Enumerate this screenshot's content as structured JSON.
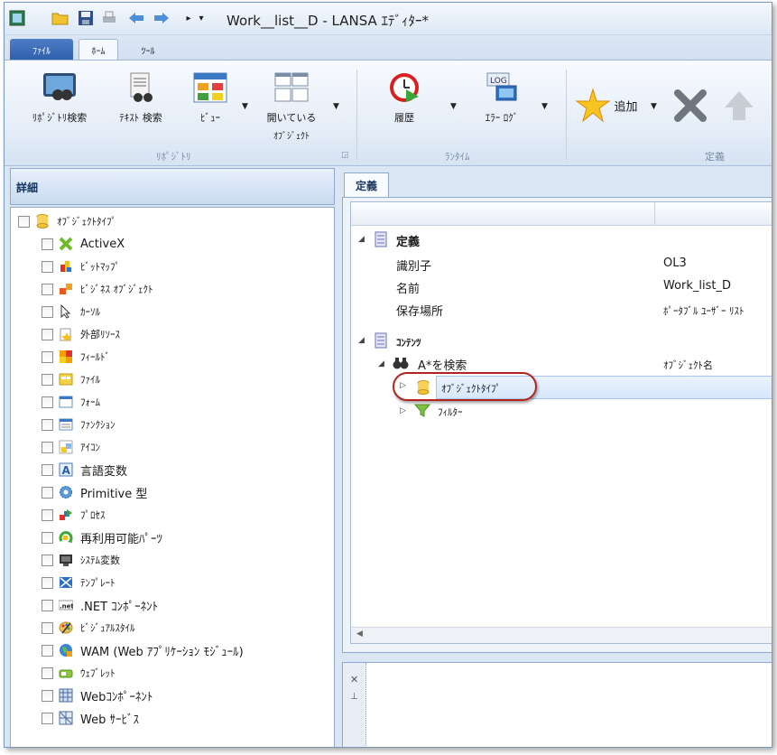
{
  "window": {
    "title": "Work__list__D - LANSA ｴﾃﾞｨﾀｰ*"
  },
  "ribbon_tabs": {
    "file": "ﾌｧｲﾙ",
    "home": "ﾎｰﾑ",
    "tools": "ﾂｰﾙ"
  },
  "ribbon": {
    "repo_search": "ﾘﾎﾟｼﾞﾄﾘ検索",
    "text_search": "ﾃｷｽﾄ 検索",
    "view": "ﾋﾞｭｰ",
    "open_objects_1": "開いている",
    "open_objects_2": "ｵﾌﾞｼﾞｪｸﾄ",
    "history": "履歴",
    "error_log": "ｴﾗｰ ﾛｸﾞ",
    "add": "追加",
    "group_repository": "ﾘﾎﾟｼﾞﾄﾘ",
    "group_runtime": "ﾗﾝﾀｲﾑ",
    "group_definition": "定義",
    "log_badge": "LOG"
  },
  "left_panel": {
    "title": "詳細",
    "root": "ｵﾌﾞｼﾞｪｸﾄﾀｲﾌﾟ",
    "items": [
      "ActiveX",
      "ﾋﾞｯﾄﾏｯﾌﾟ",
      "ﾋﾞｼﾞﾈｽ ｵﾌﾞｼﾞｪｸﾄ",
      "ｶｰｿﾙ",
      "外部ﾘｿｰｽ",
      "ﾌｨｰﾙﾄﾞ",
      "ﾌｧｲﾙ",
      "ﾌｫｰﾑ",
      "ﾌｧﾝｸｼｮﾝ",
      "ｱｲｺﾝ",
      "言語変数",
      "Primitive 型",
      "ﾌﾟﾛｾｽ",
      "再利用可能ﾊﾟｰﾂ",
      "ｼｽﾃﾑ変数",
      "ﾃﾝﾌﾟﾚｰﾄ",
      ".NET ｺﾝﾎﾟｰﾈﾝﾄ",
      "ﾋﾞｼﾞｭｱﾙｽﾀｲﾙ",
      "WAM (Web ｱﾌﾟﾘｹｰｼｮﾝ ﾓｼﾞｭｰﾙ)",
      "ｳｪﾌﾞﾚｯﾄ",
      "Webｺﾝﾎﾟｰﾈﾝﾄ",
      "Web ｻｰﾋﾞｽ"
    ]
  },
  "right_panel": {
    "tab": "定義",
    "definition_header": "定義",
    "identifier_label": "識別子",
    "identifier_value": "OL3",
    "name_label": "名前",
    "name_value": "Work_list_D",
    "location_label": "保存場所",
    "location_value": "ﾎﾟｰﾀﾌﾞﾙ ﾕｰｻﾞｰ ﾘｽﾄ",
    "contents_header": "ｺﾝﾃﾝﾂ",
    "search_label": "A*を検索",
    "search_value": "ｵﾌﾞｼﾞｪｸﾄ名",
    "object_type": "ｵﾌﾞｼﾞｪｸﾄﾀｲﾌﾟ",
    "filter": "ﾌｨﾙﾀｰ"
  }
}
